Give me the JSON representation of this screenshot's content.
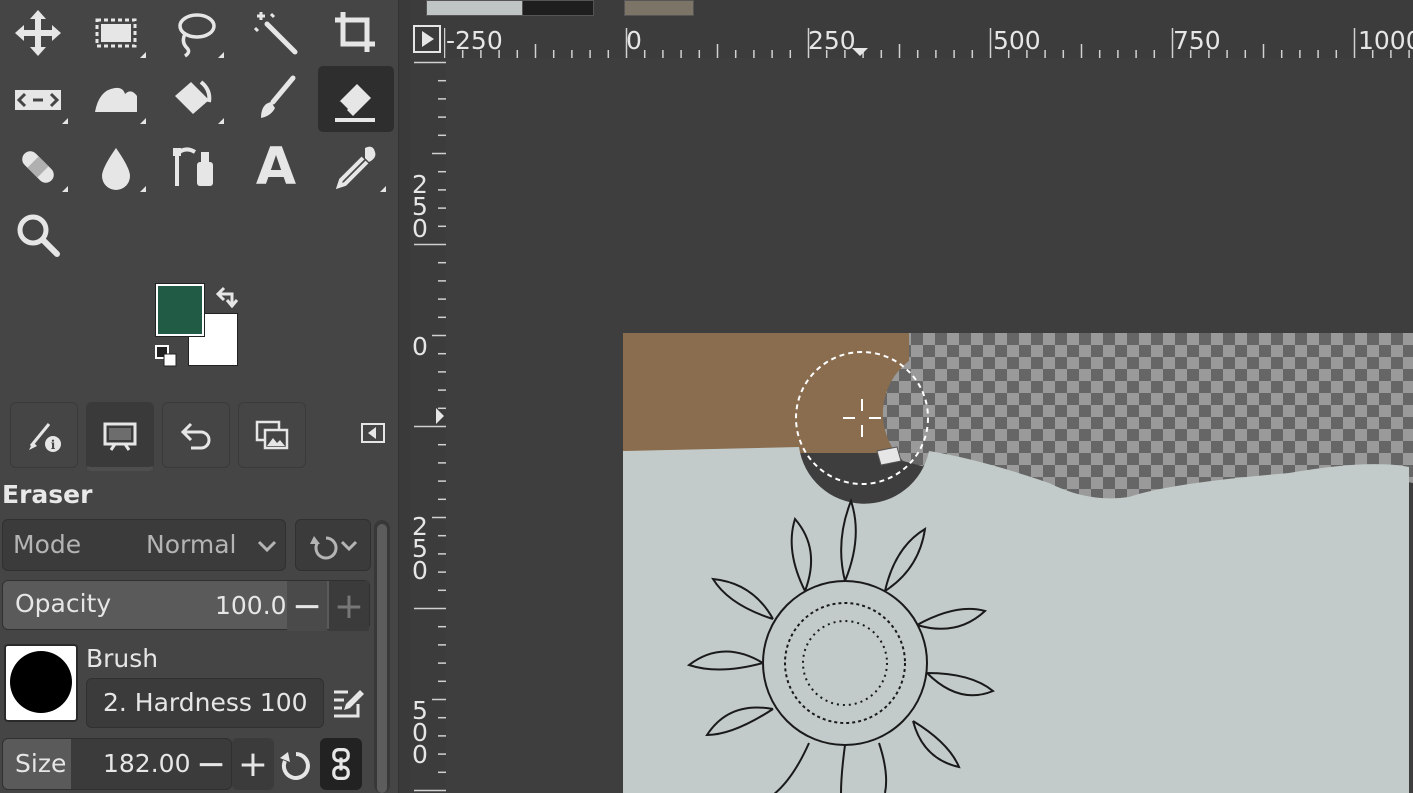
{
  "toolbox": {
    "tools": [
      {
        "name": "move-tool",
        "icon": "move-icon"
      },
      {
        "name": "rect-select-tool",
        "icon": "rect-select-icon"
      },
      {
        "name": "free-select-tool",
        "icon": "lasso-icon"
      },
      {
        "name": "fuzzy-select-tool",
        "icon": "magic-wand-icon"
      },
      {
        "name": "crop-tool",
        "icon": "crop-icon"
      },
      {
        "name": "unified-transform-tool",
        "icon": "transform-icon"
      },
      {
        "name": "warp-transform-tool",
        "icon": "warp-icon"
      },
      {
        "name": "bucket-fill-tool",
        "icon": "bucket-icon"
      },
      {
        "name": "paintbrush-tool",
        "icon": "paintbrush-icon"
      },
      {
        "name": "eraser-tool",
        "icon": "eraser-icon",
        "active": true
      },
      {
        "name": "heal-tool",
        "icon": "bandage-icon"
      },
      {
        "name": "smudge-tool",
        "icon": "drop-icon"
      },
      {
        "name": "paths-tool",
        "icon": "paths-icon"
      },
      {
        "name": "text-tool",
        "icon": "text-icon"
      },
      {
        "name": "color-picker-tool",
        "icon": "eyedropper-icon"
      },
      {
        "name": "zoom-tool",
        "icon": "zoom-icon"
      }
    ],
    "text_tool_glyph": "A",
    "foreground_color": "#215b45",
    "background_color": "#ffffff"
  },
  "dock_tabs": [
    {
      "name": "tool-options",
      "icon": "tool-options-icon"
    },
    {
      "name": "device-status",
      "icon": "device-status-icon",
      "active": true
    },
    {
      "name": "undo-history",
      "icon": "undo-icon"
    },
    {
      "name": "images",
      "icon": "images-icon"
    }
  ],
  "tool_options": {
    "title": "Eraser",
    "mode_label": "Mode",
    "mode_value": "Normal",
    "opacity_label": "Opacity",
    "opacity_value": "100.0",
    "brush_label": "Brush",
    "brush_name": "2. Hardness 100",
    "size_label": "Size",
    "size_value": "182.00",
    "minus": "−",
    "plus": "+"
  },
  "rulers": {
    "horizontal": [
      "-250",
      "0",
      "250",
      "500",
      "750",
      "1000"
    ],
    "vertical": [
      [
        "2",
        "5",
        "0"
      ],
      [
        "0"
      ],
      [
        "2",
        "5",
        "0"
      ],
      [
        "5",
        "0",
        "0"
      ]
    ]
  },
  "colors": {
    "accent_green": "#215b45",
    "panel": "#454545",
    "canvas": "#3e3e3e"
  }
}
